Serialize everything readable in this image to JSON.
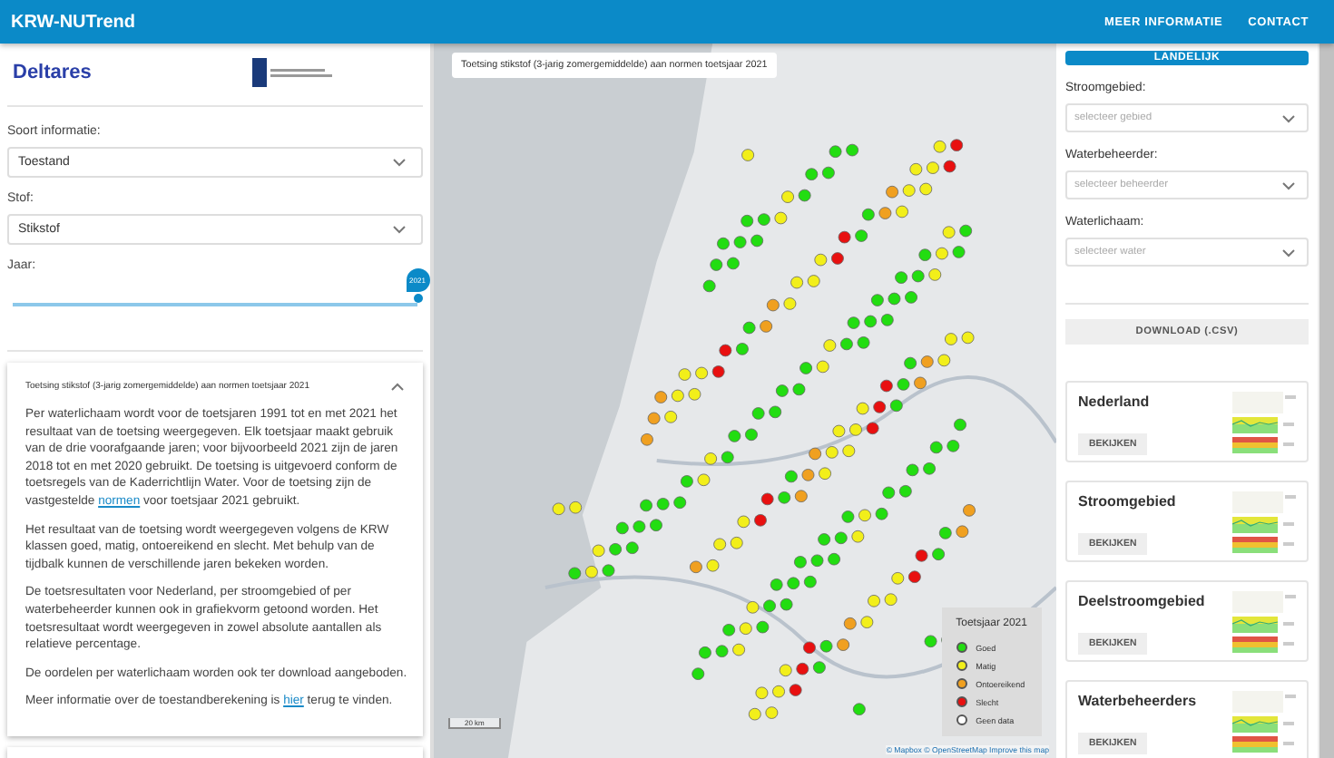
{
  "app_bar": {
    "title": "KRW-NUTrend",
    "links": [
      "MEER INFORMATIE",
      "CONTACT"
    ]
  },
  "left_panel": {
    "logo": "Deltares",
    "fields": [
      {
        "label": "Soort informatie:",
        "value": "Toestand"
      },
      {
        "label": "Stof:",
        "value": "Stikstof"
      }
    ],
    "year": {
      "label": "Jaar:",
      "value": "2021",
      "level": 1
    },
    "accordion": {
      "title": "Toetsing stikstof (3-jarig zomergemiddelde) aan normen toetsjaar 2021",
      "expanded": true,
      "paragraphs": [
        {
          "before": "Per waterlichaam wordt voor de toetsjaren 1991 tot en met 2021 het resultaat van de toetsing weergegeven. Elk toetsjaar maakt gebruik van de drie voorafgaande jaren; voor bijvoorbeeld 2021 zijn de jaren 2018 tot en met 2020 gebruikt. De toetsing is uitgevoerd conform de toetsregels van de Kaderrichtlijn Water. Voor de toetsing zijn de vastgestelde ",
          "link": "normen",
          "after": " voor toetsjaar 2021 gebruikt."
        },
        {
          "before": "Het resultaat van de toetsing wordt weergegeven volgens de KRW klassen goed, matig, ontoereikend en slecht. Met behulp van de tijdbalk kunnen de verschillende jaren bekeken worden."
        },
        {
          "before": "De toetsresultaten voor Nederland, per stroomgebied of per waterbeheerder kunnen ook in grafiekvorm getoond worden. Het toetsresultaat wordt weergegeven in zowel absolute aantallen als relatieve percentage."
        },
        {
          "before": "De oordelen per waterlichaam worden ook ter download aangeboden."
        },
        {
          "before": "Meer informatie over de toestandberekening is ",
          "link": "hier",
          "after": " terug te vinden."
        }
      ]
    }
  },
  "map": {
    "title": "Toetsing stikstof (3-jarig zomergemiddelde) aan normen toetsjaar 2021",
    "legend": {
      "title": "Toetsjaar 2021",
      "items": [
        {
          "label": "Goed",
          "color": "#22dd11"
        },
        {
          "label": "Matig",
          "color": "#f2ef1a"
        },
        {
          "label": "Ontoereikend",
          "color": "#f0a020"
        },
        {
          "label": "Slecht",
          "color": "#e81010"
        },
        {
          "label": "Geen data",
          "color": "#ffffff"
        }
      ]
    },
    "scale": "20 km",
    "attribution": "© Mapbox © OpenStreetMap Improve this map"
  },
  "right_panel": {
    "national_button": "LANDELIJK",
    "filters": [
      {
        "label": "Stroomgebied:",
        "placeholder": "selecteer gebied"
      },
      {
        "label": "Waterbeheerder:",
        "placeholder": "selecteer beheerder"
      },
      {
        "label": "Waterlichaam:",
        "placeholder": "selecteer water"
      }
    ],
    "download_button": "DOWNLOAD (.CSV)",
    "cards": [
      {
        "title": "Nederland",
        "button": "BEKIJKEN"
      },
      {
        "title": "Stroomgebied",
        "button": "BEKIJKEN"
      },
      {
        "title": "Deelstroomgebied",
        "button": "BEKIJKEN"
      },
      {
        "title": "Waterbeheerders",
        "button": "BEKIJKEN"
      }
    ]
  }
}
